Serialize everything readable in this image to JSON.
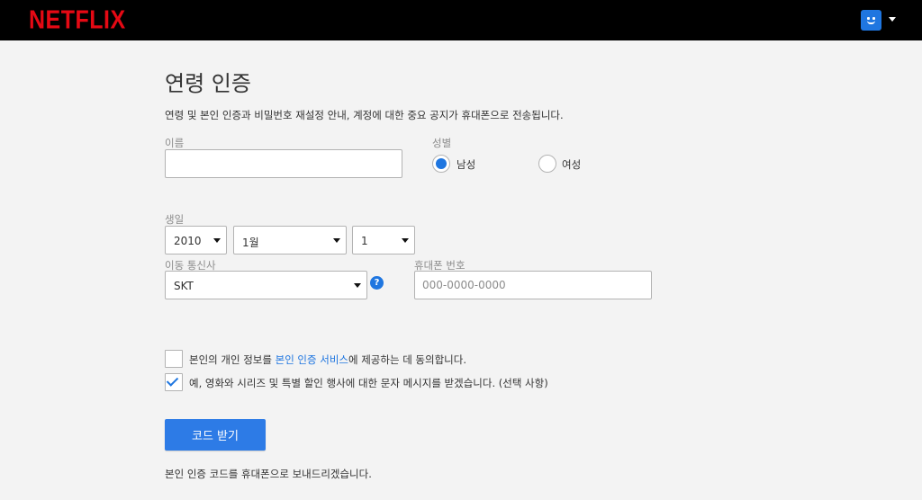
{
  "header": {
    "logo": "NETFLIX",
    "profile_icon": "smiley-avatar-icon",
    "menu_icon": "caret-down-icon"
  },
  "main": {
    "title": "연령 인증",
    "subtitle": "연령 및 본인 인증과 비밀번호 재설정 안내, 계정에 대한 중요 공지가 휴대폰으로 전송됩니다.",
    "name": {
      "label": "이름",
      "value": "",
      "placeholder": ""
    },
    "gender": {
      "label": "성별",
      "options": [
        {
          "label": "남성",
          "selected": true
        },
        {
          "label": "여성",
          "selected": false
        }
      ]
    },
    "birth": {
      "label": "생일",
      "year": "2010",
      "month": "1월",
      "day": "1"
    },
    "carrier": {
      "label": "이동 통신사",
      "value": "SKT",
      "help_icon": "question-mark-icon"
    },
    "phone": {
      "label": "휴대폰 번호",
      "value": "",
      "placeholder": "000-0000-0000"
    },
    "consents": [
      {
        "prefix": "본인의 개인 정보를 ",
        "link": "본인 인증 서비스",
        "suffix": "에 제공하는 데 동의합니다.",
        "checked": false
      },
      {
        "text": "예, 영화와 시리즈 및 특별 할인 행사에 대한 문자 메시지를 받겠습니다. (선택 사항)",
        "checked": true
      }
    ],
    "submit_label": "코드 받기",
    "note": "본인 인증 코드를 휴대폰으로 보내드리겠습니다."
  },
  "colors": {
    "brand": "#e50914",
    "accent": "#1f76e0",
    "button": "#2d7be6",
    "background": "#f3f3f3",
    "header": "#000000"
  }
}
